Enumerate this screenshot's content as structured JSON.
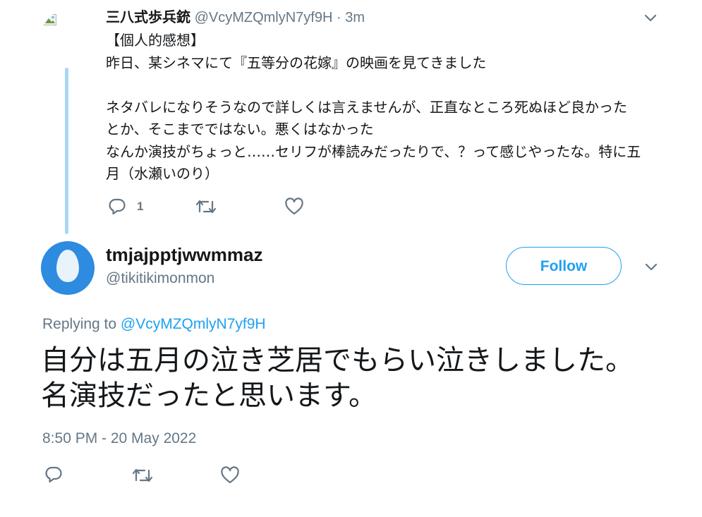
{
  "parent_tweet": {
    "display_name": "三八式歩兵銃",
    "handle": "@VcyMZQmlyN7yf9H",
    "time": "· 3m",
    "lines": [
      "【個人的感想】",
      "昨日、某シネマにて『五等分の花嫁』の映画を見てきました",
      "",
      "ネタバレになりそうなので詳しくは言えませんが、正直なところ死ぬほど良かった",
      "とか、そこまでではない。悪くはなかった",
      "なんか演技がちょっと……セリフが棒読みだったりで、？って感じやったな。特に五",
      "月（水瀬いのり）"
    ],
    "reply_count": "1",
    "icons": [
      "broken-image-icon",
      "chevron-down-icon",
      "reply-icon",
      "retweet-icon",
      "like-icon"
    ]
  },
  "main_tweet": {
    "display_name": "tmjajpptjwwmmaz",
    "handle": "@tikitikimonmon",
    "follow_label": "Follow",
    "replying_prefix": "Replying to",
    "replying_to": "@VcyMZQmlyN7yf9H",
    "lines": [
      "自分は五月の泣き芝居でもらい泣きしました。",
      "名演技だったと思います。"
    ],
    "timestamp": "8:50 PM - 20 May 2022",
    "icons": [
      "default-egg-avatar",
      "chevron-down-icon",
      "reply-icon",
      "retweet-icon",
      "like-icon"
    ]
  },
  "colors": {
    "accent": "#1da1f2",
    "text": "#14171a",
    "muted": "#657786",
    "thread_line": "#a9d6f5",
    "avatar_blue": "#2d8be0"
  }
}
